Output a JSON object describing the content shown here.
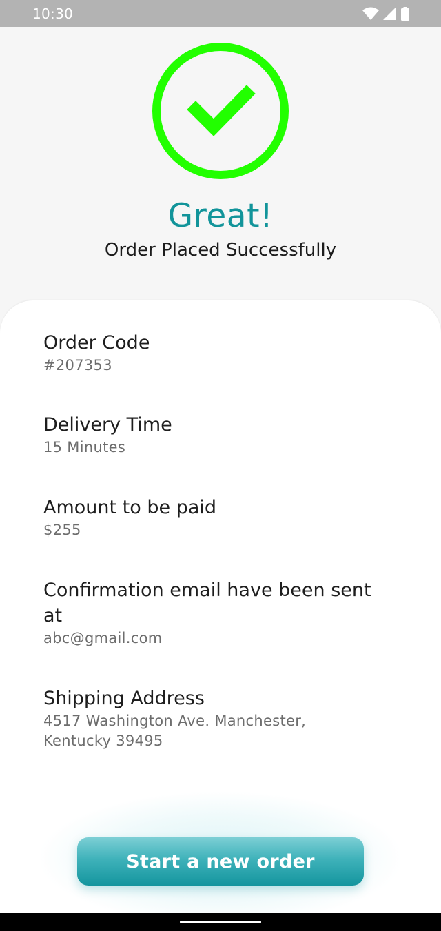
{
  "status_bar": {
    "time": "10:30",
    "icons": [
      "wifi-icon",
      "signal-icon",
      "battery-icon"
    ]
  },
  "success": {
    "icon": "check-circle-icon",
    "color": "#22ff00",
    "headline": "Great!",
    "subheadline": "Order Placed Successfully"
  },
  "details": [
    {
      "label": "Order Code",
      "value": "#207353"
    },
    {
      "label": "Delivery Time",
      "value": "15 Minutes"
    },
    {
      "label": "Amount to be paid",
      "value": "$255"
    },
    {
      "label": "Confirmation email have been sent at",
      "value": "abc@gmail.com"
    },
    {
      "label": "Shipping Address",
      "value": "4517 Washington Ave. Manchester, Kentucky 39495"
    }
  ],
  "actions": {
    "new_order_label": "Start a new order"
  },
  "colors": {
    "accent": "#12949a",
    "success": "#22ff00"
  }
}
